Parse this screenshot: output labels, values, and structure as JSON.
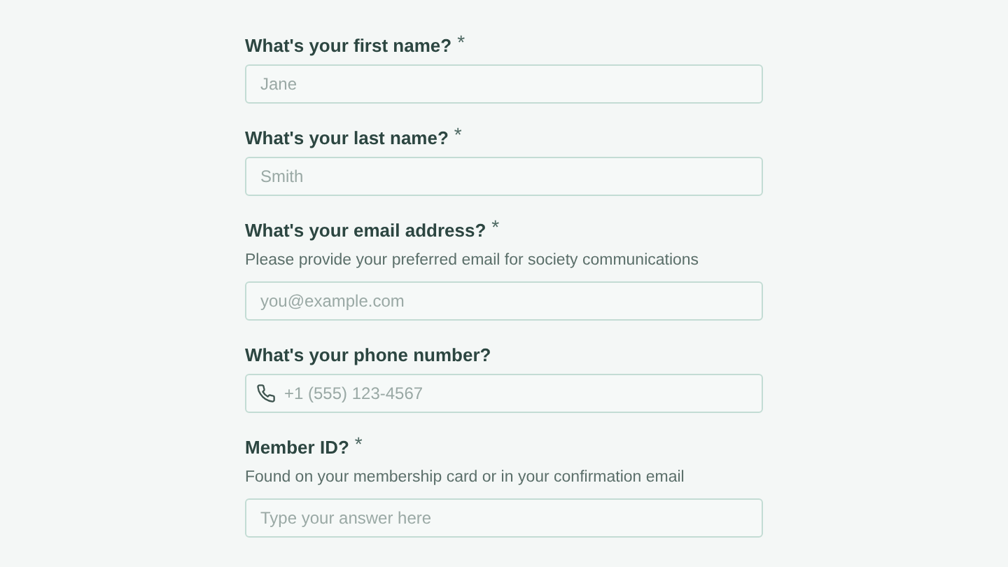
{
  "fields": [
    {
      "kind": "text",
      "label": "What's your first name?",
      "required_mark": "*",
      "placeholder": "Jane"
    },
    {
      "kind": "text",
      "label": "What's your last name?",
      "required_mark": "*",
      "placeholder": "Smith"
    },
    {
      "kind": "text",
      "label": "What's your email address?",
      "required_mark": "*",
      "hint": "Please provide your preferred email for society communications",
      "placeholder": "you@example.com"
    },
    {
      "kind": "phone",
      "label": "What's your phone number?",
      "placeholder": "+1 (555) 123-4567"
    },
    {
      "kind": "text",
      "label": "Member ID?",
      "required_mark": "*",
      "hint": "Found on your membership card or in your confirmation email",
      "placeholder": "Type your answer here"
    }
  ]
}
